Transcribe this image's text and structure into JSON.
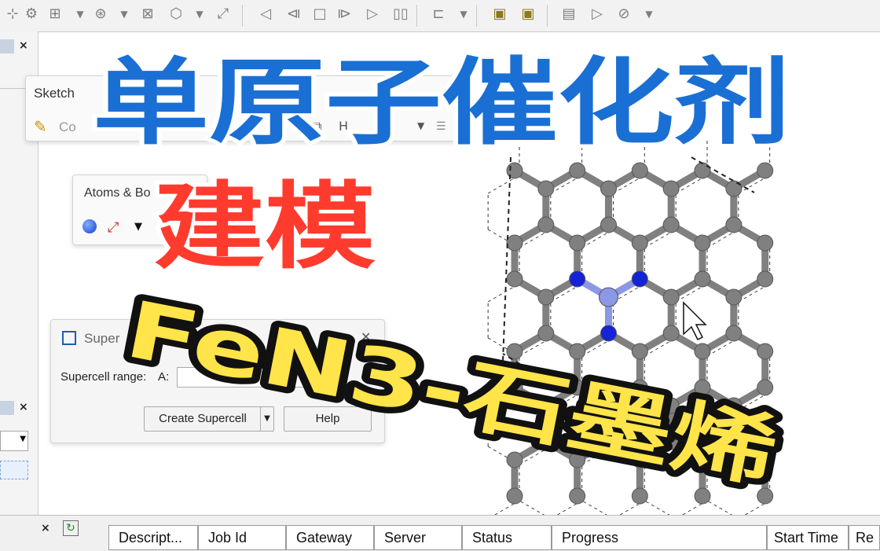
{
  "colors": {
    "title_blue": "#1a6fd4",
    "title_red": "#ff3b2e",
    "title_yellow": "#ffe44a",
    "carbon": "#808080",
    "nitrogen": "#1523d8",
    "iron": "#8c97e6"
  },
  "toolbar": {
    "icons": [
      "select-icon",
      "move-icon",
      "rotate-icon",
      "translate-icon",
      "zoom-icon",
      "rotate-3d-icon",
      "measure-icon",
      "first-frame-icon",
      "prev-frame-icon",
      "stop-icon",
      "next-frame-icon",
      "last-frame-icon",
      "pause-icon",
      "export-icon",
      "cube-icon",
      "cube2-icon",
      "doc-icon",
      "play-icon",
      "settings-icon"
    ]
  },
  "sketch": {
    "title": "Sketch",
    "pencil_label": "Co"
  },
  "atoms_bonds": {
    "title": "Atoms & Bo"
  },
  "supercell": {
    "title": "Super",
    "size_label": "Supercell range:",
    "a_label": "A:",
    "create_label": "Create Supercell",
    "help_label": "Help"
  },
  "overlay": {
    "line1": "单原子催化剂",
    "line2": "建模",
    "line3": "FeN3-石墨烯"
  },
  "jobs": {
    "columns": [
      "Descript...",
      "Job Id",
      "Gateway",
      "Server",
      "Status",
      "Progress",
      "Start Time",
      "Re"
    ]
  }
}
